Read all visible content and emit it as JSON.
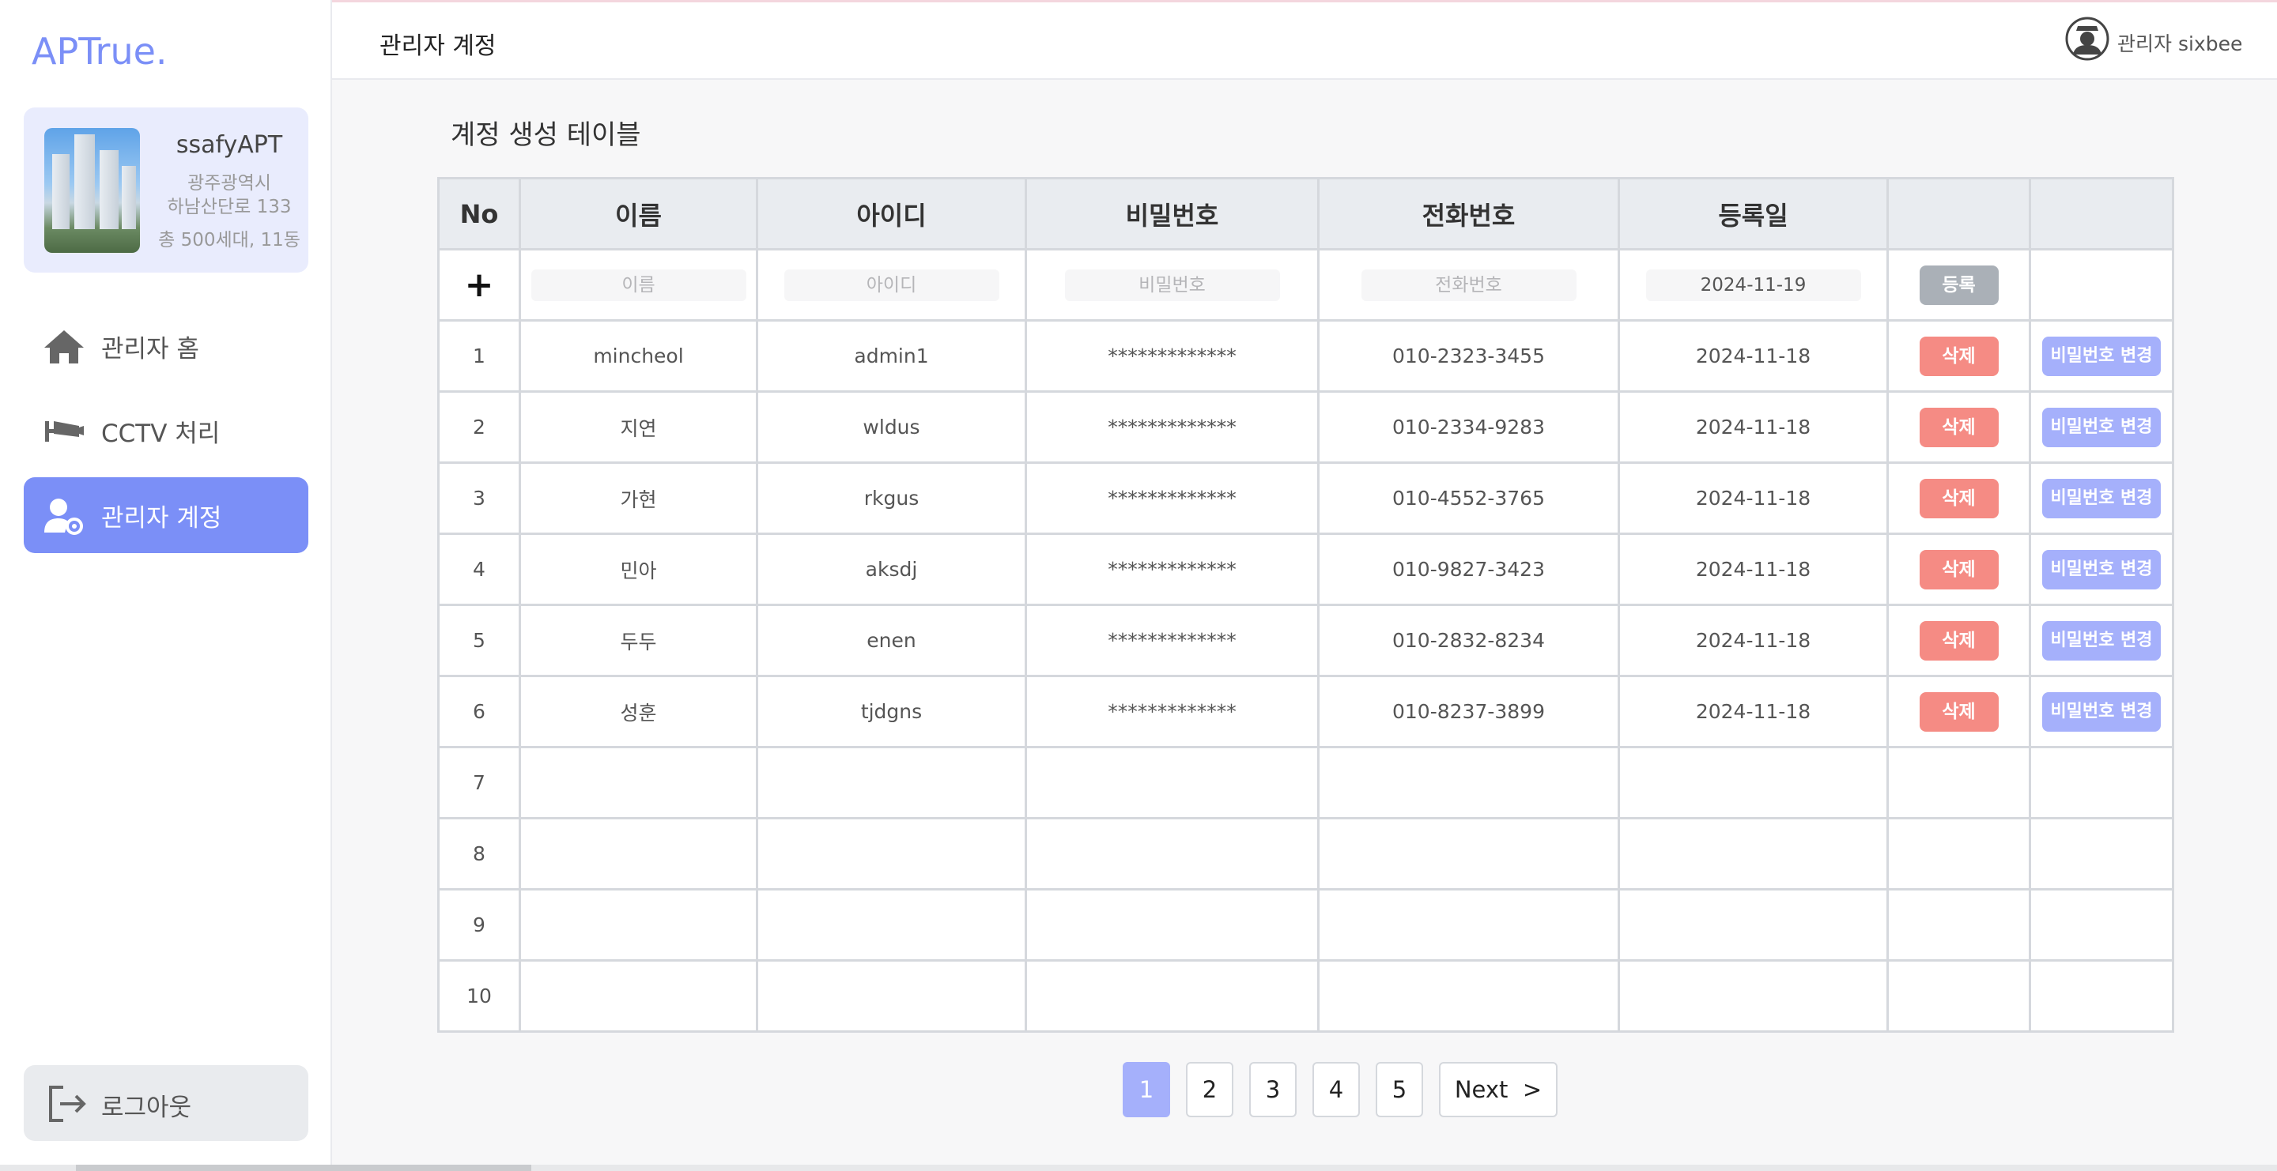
{
  "app": {
    "logo": "APTrue."
  },
  "apartment": {
    "name": "ssafyAPT",
    "city": "광주광역시",
    "address": "하남산단로 133",
    "summary": "총 500세대, 11동"
  },
  "sidebar": {
    "items": [
      {
        "label": "관리자 홈",
        "icon": "home-icon",
        "active": false
      },
      {
        "label": "CCTV 처리",
        "icon": "cctv-icon",
        "active": false
      },
      {
        "label": "관리자 계정",
        "icon": "user-gear-icon",
        "active": true
      }
    ],
    "logout_label": "로그아웃"
  },
  "header": {
    "title": "관리자 계정",
    "user": "관리자 sixbee"
  },
  "main": {
    "section_title": "계정 생성 테이블",
    "columns": [
      "No",
      "이름",
      "아이디",
      "비밀번호",
      "전화번호",
      "등록일",
      "",
      ""
    ],
    "new_row": {
      "name_placeholder": "이름",
      "id_placeholder": "아이디",
      "password_placeholder": "비밀번호",
      "phone_placeholder": "전화번호",
      "date_value": "2024-11-19",
      "register_label": "등록"
    },
    "delete_label": "삭제",
    "change_pw_label": "비밀번호 변경",
    "rows": [
      {
        "no": "1",
        "name": "mincheol",
        "id": "admin1",
        "password": "*************",
        "phone": "010-2323-3455",
        "date": "2024-11-18"
      },
      {
        "no": "2",
        "name": "지연",
        "id": "wldus",
        "password": "*************",
        "phone": "010-2334-9283",
        "date": "2024-11-18"
      },
      {
        "no": "3",
        "name": "가현",
        "id": "rkgus",
        "password": "*************",
        "phone": "010-4552-3765",
        "date": "2024-11-18"
      },
      {
        "no": "4",
        "name": "민아",
        "id": "aksdj",
        "password": "*************",
        "phone": "010-9827-3423",
        "date": "2024-11-18"
      },
      {
        "no": "5",
        "name": "두두",
        "id": "enen",
        "password": "*************",
        "phone": "010-2832-8234",
        "date": "2024-11-18"
      },
      {
        "no": "6",
        "name": "성훈",
        "id": "tjdgns",
        "password": "*************",
        "phone": "010-8237-3899",
        "date": "2024-11-18"
      }
    ],
    "empty_rows": [
      "7",
      "8",
      "9",
      "10"
    ]
  },
  "pagination": {
    "pages": [
      "1",
      "2",
      "3",
      "4",
      "5"
    ],
    "current": "1",
    "next_label": "Next  >"
  },
  "colors": {
    "accent": "#7b8ff7",
    "delete": "#f58b84",
    "change_pw": "#a5b0fb",
    "register": "#aab0b7"
  }
}
